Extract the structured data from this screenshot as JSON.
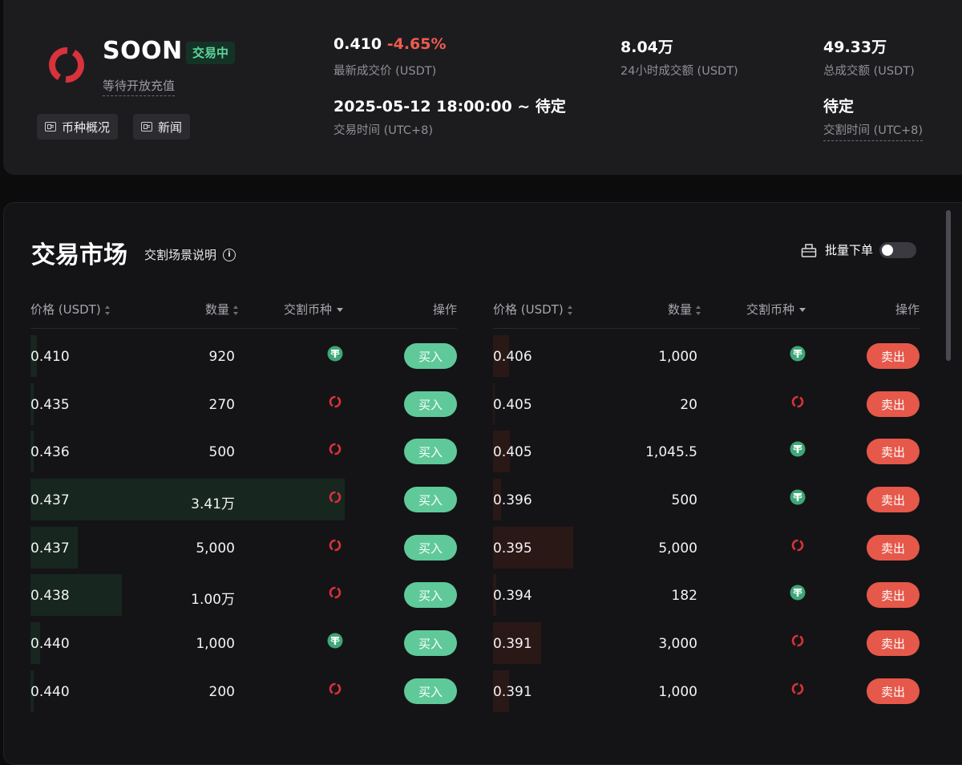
{
  "header": {
    "coin_name": "SOON",
    "status_badge": "交易中",
    "deposit_status": "等待开放充值",
    "chips": [
      "币种概况",
      "新闻"
    ],
    "last_price": "0.410",
    "price_change": "-4.65%",
    "last_price_label": "最新成交价 (USDT)",
    "volume_24h": "8.04万",
    "volume_24h_label": "24小时成交额 (USDT)",
    "total_volume": "49.33万",
    "total_volume_label": "总成交额 (USDT)",
    "trade_time": "2025-05-12 18:00:00 ~ 待定",
    "trade_time_label": "交易时间 (UTC+8)",
    "delivery_time": "待定",
    "delivery_time_label": "交割时间 (UTC+8)"
  },
  "market": {
    "title": "交易市场",
    "scene_link": "交割场景说明",
    "batch_order": "批量下单",
    "batch_enabled": false,
    "columns": {
      "price": "价格 (USDT)",
      "qty": "数量",
      "currency": "交割币种",
      "action": "操作"
    },
    "buy_orders": [
      {
        "price": "0.410",
        "qty": "920",
        "currency": "usdt-icon",
        "depth": 0.02,
        "action": "买入"
      },
      {
        "price": "0.435",
        "qty": "270",
        "currency": "soon-icon",
        "depth": 0.01,
        "action": "买入"
      },
      {
        "price": "0.436",
        "qty": "500",
        "currency": "soon-icon",
        "depth": 0.01,
        "action": "买入"
      },
      {
        "price": "0.437",
        "qty": "3.41万",
        "currency": "soon-icon",
        "depth": 1.0,
        "action": "买入"
      },
      {
        "price": "0.437",
        "qty": "5,000",
        "currency": "soon-icon",
        "depth": 0.15,
        "action": "买入"
      },
      {
        "price": "0.438",
        "qty": "1.00万",
        "currency": "soon-icon",
        "depth": 0.29,
        "action": "买入"
      },
      {
        "price": "0.440",
        "qty": "1,000",
        "currency": "usdt-icon",
        "depth": 0.03,
        "action": "买入"
      },
      {
        "price": "0.440",
        "qty": "200",
        "currency": "soon-icon",
        "depth": 0.01,
        "action": "买入"
      }
    ],
    "sell_orders": [
      {
        "price": "0.406",
        "qty": "1,000",
        "currency": "usdt-icon",
        "depth": 0.2,
        "action": "卖出"
      },
      {
        "price": "0.405",
        "qty": "20",
        "currency": "soon-icon",
        "depth": 0.01,
        "action": "卖出"
      },
      {
        "price": "0.405",
        "qty": "1,045.5",
        "currency": "usdt-icon",
        "depth": 0.21,
        "action": "卖出"
      },
      {
        "price": "0.396",
        "qty": "500",
        "currency": "usdt-icon",
        "depth": 0.1,
        "action": "卖出"
      },
      {
        "price": "0.395",
        "qty": "5,000",
        "currency": "soon-icon",
        "depth": 1.0,
        "action": "卖出"
      },
      {
        "price": "0.394",
        "qty": "182",
        "currency": "usdt-icon",
        "depth": 0.04,
        "action": "卖出"
      },
      {
        "price": "0.391",
        "qty": "3,000",
        "currency": "soon-icon",
        "depth": 0.6,
        "action": "卖出"
      },
      {
        "price": "0.391",
        "qty": "1,000",
        "currency": "soon-icon",
        "depth": 0.2,
        "action": "卖出"
      }
    ]
  },
  "colors": {
    "accent_green": "#5fc99a",
    "accent_red": "#e5584a",
    "brand_red": "#d8323c"
  }
}
